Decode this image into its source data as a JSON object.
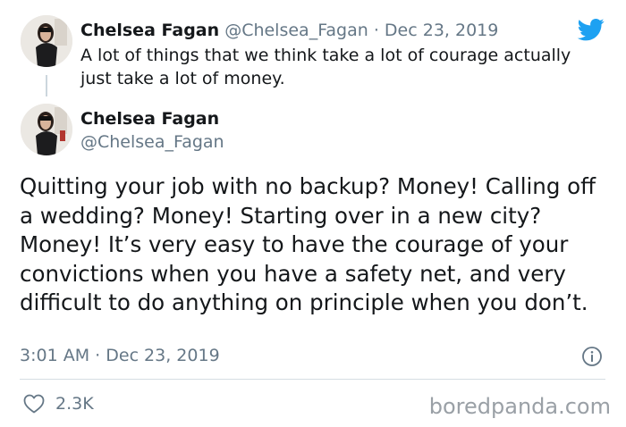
{
  "reply_tweet": {
    "author_name": "Chelsea Fagan",
    "handle": "@Chelsea_Fagan",
    "date": "Dec 23, 2019",
    "separator": "·",
    "text": "A lot of things that we think take a lot of courage actually just take a lot of money."
  },
  "main_tweet": {
    "author_name": "Chelsea Fagan",
    "handle": "@Chelsea_Fagan",
    "text": "Quitting your job with no backup? Money! Calling off a wedding? Money! Starting over in a new city? Money! It’s very easy to have the courage of your convictions when you have a safety net, and very difficult to do anything on principle when you don’t.",
    "time": "3:01 AM",
    "date": "Dec 23, 2019",
    "separator": "·",
    "likes": "2.3K"
  },
  "icons": {
    "brand": "twitter-bird-icon",
    "info": "info-icon",
    "like": "heart-icon"
  },
  "watermark": "boredpanda.com",
  "colors": {
    "twitter_blue": "#1da1f2",
    "secondary_text": "#657786",
    "primary_text": "#14171a",
    "divider": "#d5dde2"
  }
}
